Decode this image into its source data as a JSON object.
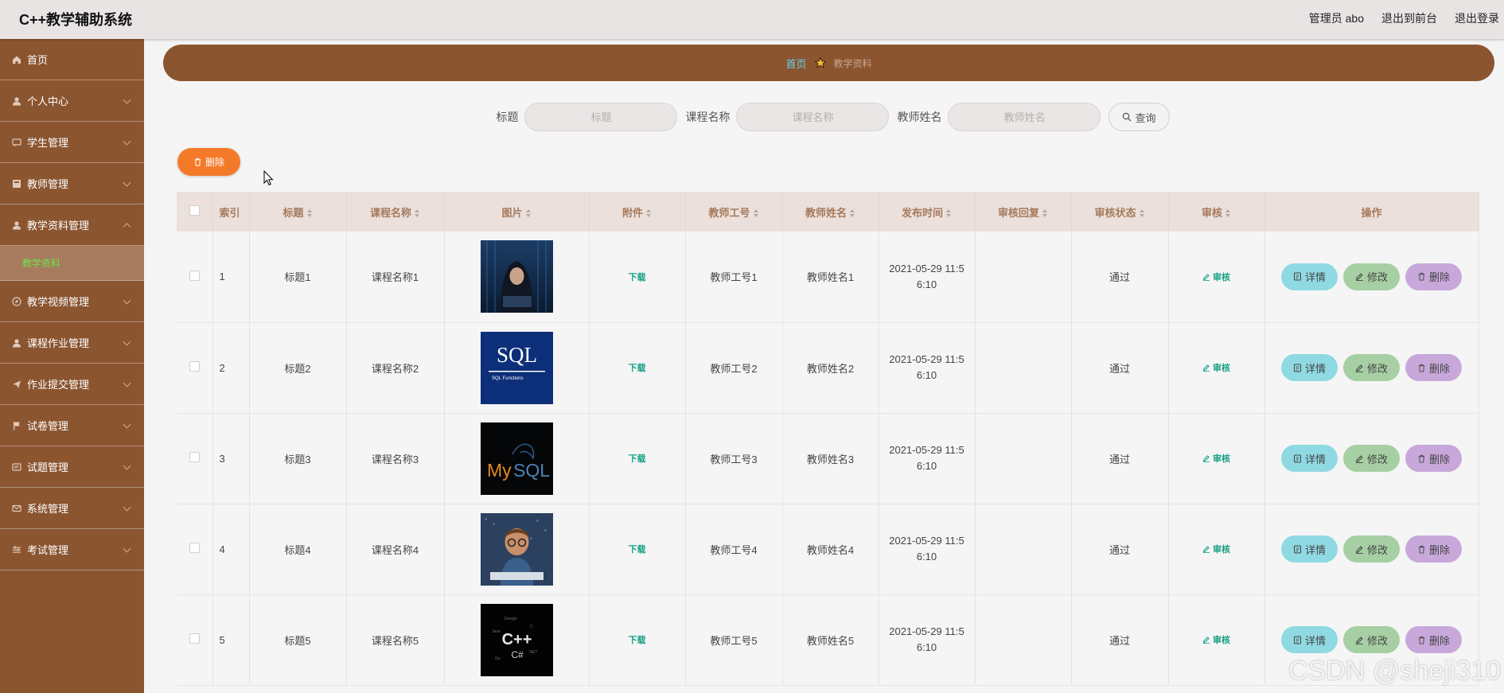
{
  "app": {
    "title": "C++教学辅助系统"
  },
  "topnav": {
    "user": "管理员 abo",
    "to_front": "退出到前台",
    "logout": "退出登录"
  },
  "sidebar": {
    "items": [
      {
        "label": "首页",
        "icon": "home-icon"
      },
      {
        "label": "个人中心",
        "icon": "user-icon"
      },
      {
        "label": "学生管理",
        "icon": "chat-icon"
      },
      {
        "label": "教师管理",
        "icon": "grid-icon"
      },
      {
        "label": "教学资料管理",
        "icon": "user-icon"
      },
      {
        "label": "教学视频管理",
        "icon": "compass-icon"
      },
      {
        "label": "课程作业管理",
        "icon": "user-icon"
      },
      {
        "label": "作业提交管理",
        "icon": "send-icon"
      },
      {
        "label": "试卷管理",
        "icon": "flag-icon"
      },
      {
        "label": "试题管理",
        "icon": "list-icon"
      },
      {
        "label": "系统管理",
        "icon": "mail-icon"
      },
      {
        "label": "考试管理",
        "icon": "sliders-icon"
      }
    ],
    "submenu": {
      "label": "教学资料"
    }
  },
  "breadcrumb": {
    "home": "首页",
    "current": "教学资料"
  },
  "search": {
    "title_label": "标题",
    "title_placeholder": "标题",
    "course_label": "课程名称",
    "course_placeholder": "课程名称",
    "teacher_label": "教师姓名",
    "teacher_placeholder": "教师姓名",
    "button": "查询"
  },
  "bulk_delete": "删除",
  "table": {
    "headers": {
      "index": "索引",
      "title": "标题",
      "course": "课程名称",
      "image": "图片",
      "attachment": "附件",
      "teacher_id": "教师工号",
      "teacher_name": "教师姓名",
      "publish_time": "发布时间",
      "audit_reply": "审核回复",
      "audit_status": "审核状态",
      "audit": "审核",
      "actions": "操作"
    },
    "rows": [
      {
        "index": "1",
        "title": "标题1",
        "course": "课程名称1",
        "attachment": "下载",
        "teacher_id": "教师工号1",
        "teacher_name": "教师姓名1",
        "time_a": "2021-05-29 11:5",
        "time_b": "6:10",
        "audit_reply": "",
        "audit_status": "通过",
        "audit": "审核",
        "image": "hacker"
      },
      {
        "index": "2",
        "title": "标题2",
        "course": "课程名称2",
        "attachment": "下载",
        "teacher_id": "教师工号2",
        "teacher_name": "教师姓名2",
        "time_a": "2021-05-29 11:5",
        "time_b": "6:10",
        "audit_reply": "",
        "audit_status": "通过",
        "audit": "审核",
        "image": "sql"
      },
      {
        "index": "3",
        "title": "标题3",
        "course": "课程名称3",
        "attachment": "下载",
        "teacher_id": "教师工号3",
        "teacher_name": "教师姓名3",
        "time_a": "2021-05-29 11:5",
        "time_b": "6:10",
        "audit_reply": "",
        "audit_status": "通过",
        "audit": "审核",
        "image": "mysql"
      },
      {
        "index": "4",
        "title": "标题4",
        "course": "课程名称4",
        "attachment": "下载",
        "teacher_id": "教师工号4",
        "teacher_name": "教师姓名4",
        "time_a": "2021-05-29 11:5",
        "time_b": "6:10",
        "audit_reply": "",
        "audit_status": "通过",
        "audit": "审核",
        "image": "kid"
      },
      {
        "index": "5",
        "title": "标题5",
        "course": "课程名称5",
        "attachment": "下载",
        "teacher_id": "教师工号5",
        "teacher_name": "教师姓名5",
        "time_a": "2021-05-29 11:5",
        "time_b": "6:10",
        "audit_reply": "",
        "audit_status": "通过",
        "audit": "审核",
        "image": "cpp"
      }
    ],
    "actions": {
      "detail": "详情",
      "edit": "修改",
      "delete": "删除"
    }
  },
  "thumb_text": {
    "sql": "SQL",
    "sql_sub": "SQL Functions",
    "mysql": "MySQL",
    "cpp": "C++",
    "cs": "C#"
  },
  "watermark": "CSDN @sheji310",
  "colors": {
    "sidebar": "#8b5530",
    "accent_orange": "#f47a2a",
    "breadcrumb_home": "#66d1ec",
    "submenu_active": "#6fe34c"
  }
}
